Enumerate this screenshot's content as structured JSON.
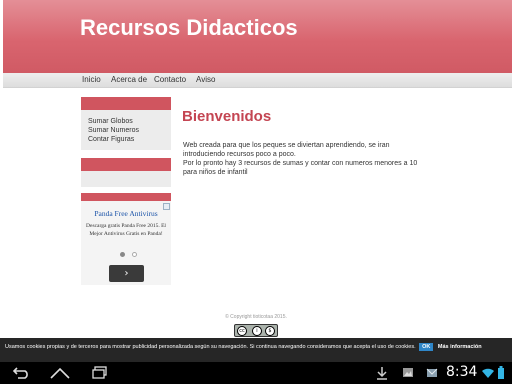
{
  "header": {
    "title": "Recursos Didacticos"
  },
  "nav": {
    "items": [
      {
        "label": "Inicio"
      },
      {
        "label": "Acerca de"
      },
      {
        "label": "Contacto"
      },
      {
        "label": "Aviso"
      }
    ]
  },
  "sidebar": {
    "links": [
      {
        "label": "Sumar Globos"
      },
      {
        "label": "Sumar Numeros"
      },
      {
        "label": "Contar Figuras"
      }
    ],
    "ad": {
      "title": "Panda Free Antivirus",
      "description": "Descarga gratis Panda Free 2015. El Mejor Antivirus Gratis en Panda!",
      "next_symbol": "›"
    }
  },
  "main": {
    "title": "Bienvenidos",
    "lines": [
      "Web creada para que los peques se diviertan aprendiendo, se iran",
      "introduciendo recursos poco a poco.",
      "Por lo pronto hay 3 recursos de sumas y contar con numeros menores a 10",
      "para niños de infantil"
    ]
  },
  "footer": {
    "copyright": "© Copyright tioticotaa 2015."
  },
  "cookie": {
    "text": "Usamos cookies propias y de terceros para mostrar publicidad personalizada según su navegación. Si continua navegando consideramos que acepta el uso de cookies.",
    "ok_label": "OK",
    "more_label": "Más información"
  },
  "system": {
    "clock": "8:34"
  },
  "colors": {
    "accent": "#d0555f",
    "title_red": "#c44552",
    "ok_blue": "#2f86c8"
  }
}
